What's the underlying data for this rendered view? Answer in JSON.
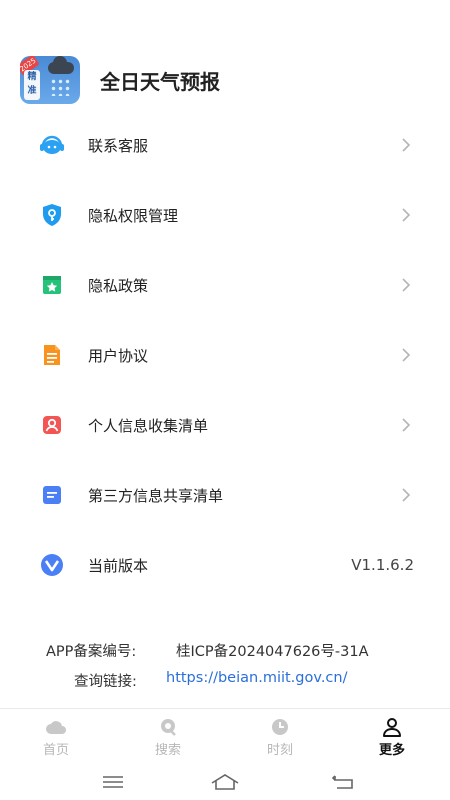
{
  "app": {
    "title": "全日天气预报",
    "icon": {
      "year_badge": "2025",
      "tag_text": "精准"
    }
  },
  "menu": [
    {
      "label": "联系客服",
      "icon": "customer-service-icon",
      "color": "#2aa1f2"
    },
    {
      "label": "隐私权限管理",
      "icon": "shield-key-icon",
      "color": "#1f9cf0"
    },
    {
      "label": "隐私政策",
      "icon": "star-bookmark-icon",
      "color": "#27c27a"
    },
    {
      "label": "用户协议",
      "icon": "document-icon",
      "color": "#f7931e"
    },
    {
      "label": "个人信息收集清单",
      "icon": "person-card-icon",
      "color": "#f35555"
    },
    {
      "label": "第三方信息共享清单",
      "icon": "list-doc-icon",
      "color": "#4a7ff5"
    },
    {
      "label": "当前版本",
      "icon": "version-v-icon",
      "color": "#4a7ff5",
      "value": "V1.1.6.2"
    }
  ],
  "footer": {
    "record_key": "APP备案编号:",
    "record_value": "桂ICP备2024047626号-31A",
    "link_key": "查询链接:",
    "link_value": "https://beian.miit.gov.cn/"
  },
  "tabs": [
    {
      "label": "首页",
      "icon": "cloud-icon",
      "active": false
    },
    {
      "label": "搜索",
      "icon": "search-bubble-icon",
      "active": false
    },
    {
      "label": "时刻",
      "icon": "clock-icon",
      "active": false
    },
    {
      "label": "更多",
      "icon": "person-icon",
      "active": true
    }
  ],
  "system_nav": [
    "menu-icon",
    "home-icon",
    "back-icon"
  ]
}
